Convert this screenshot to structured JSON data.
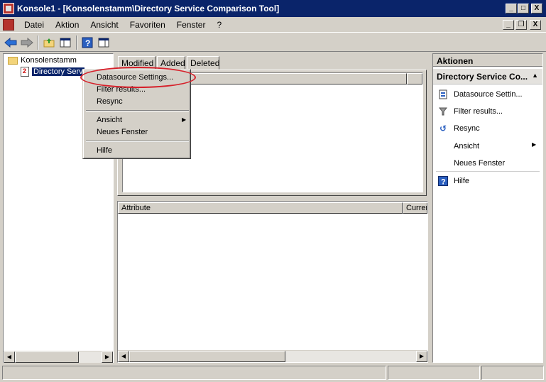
{
  "window": {
    "title": "Konsole1 - [Konsolenstamm\\Directory Service Comparison Tool]",
    "minimize": "_",
    "maximize": "□",
    "close": "X"
  },
  "menubar": {
    "items": [
      "Datei",
      "Aktion",
      "Ansicht",
      "Favoriten",
      "Fenster",
      "?"
    ]
  },
  "toolbar": {
    "buttons": [
      "back-icon",
      "forward-icon",
      "up-folder-icon",
      "show-hide-tree-icon",
      "help-icon",
      "properties-icon"
    ]
  },
  "tree": {
    "root": "Konsolenstamm",
    "child": "Directory Serv"
  },
  "tabs": [
    "Modified",
    "Added",
    "Deleted"
  ],
  "lower_list": {
    "columns": [
      "Attribute",
      "Curren"
    ]
  },
  "context_menu": {
    "items": [
      "Datasource Settings...",
      "Filter results...",
      "Resync",
      "Ansicht",
      "Neues Fenster",
      "Hilfe"
    ]
  },
  "actions": {
    "title": "Aktionen",
    "section": "Directory Service Co...",
    "items": [
      "Datasource Settin...",
      "Filter results...",
      "Resync",
      "Ansicht",
      "Neues Fenster",
      "Hilfe"
    ]
  },
  "colors": {
    "titlebar": "#0a246a",
    "highlight_ring": "#d6202a"
  }
}
